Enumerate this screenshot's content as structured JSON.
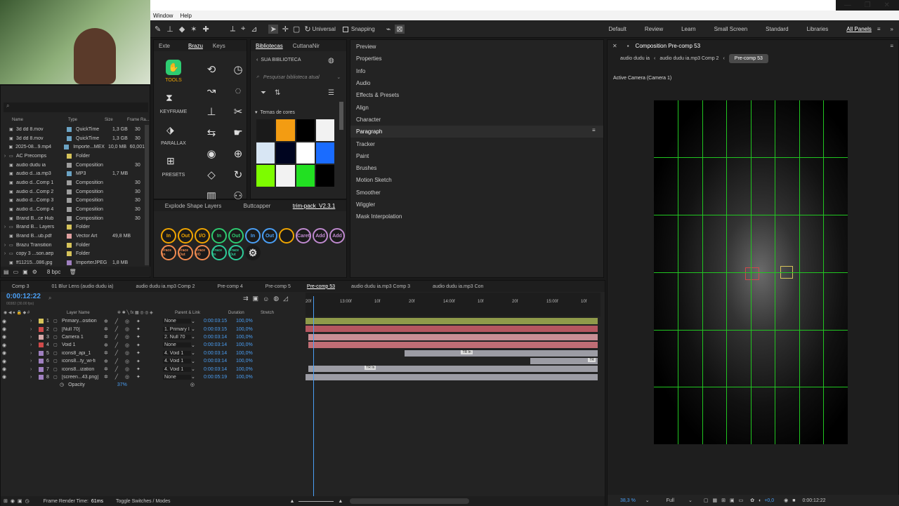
{
  "menu": {
    "window": "Window",
    "help": "Help"
  },
  "toolbar": {
    "universal": "Universal",
    "snapping": "Snapping"
  },
  "workspaces": [
    "Default",
    "Review",
    "Learn",
    "Small Screen",
    "Standard",
    "Libraries",
    "All Panels"
  ],
  "project": {
    "columns": [
      "Name",
      "Type",
      "Size",
      "Frame Ra..."
    ],
    "rows": [
      {
        "name": "3d dd 8.mov",
        "type": "QuickTime",
        "size": "1,3 GB",
        "fr": "30",
        "color": "#6ba3c4"
      },
      {
        "name": "3d dd 8.mov",
        "type": "QuickTime",
        "size": "1,3 GB",
        "fr": "30",
        "color": "#6ba3c4"
      },
      {
        "name": "2025-08...9.mp4",
        "type": "Importe...MEX",
        "size": "10,0 MB",
        "fr": "60,001",
        "color": "#6ba3c4"
      },
      {
        "name": "AC Precomps",
        "type": "Folder",
        "size": "",
        "fr": "",
        "color": "#d6c35a"
      },
      {
        "name": "audio dudu ia",
        "type": "Composition",
        "size": "",
        "fr": "30",
        "color": "#9e9e9e"
      },
      {
        "name": "audio d...ia.mp3",
        "type": "MP3",
        "size": "1,7 MB",
        "fr": "",
        "color": "#6ba3c4"
      },
      {
        "name": "audio d...Comp 1",
        "type": "Composition",
        "size": "",
        "fr": "30",
        "color": "#9e9e9e"
      },
      {
        "name": "audio d...Comp 2",
        "type": "Composition",
        "size": "",
        "fr": "30",
        "color": "#9e9e9e"
      },
      {
        "name": "audio d...Comp 3",
        "type": "Composition",
        "size": "",
        "fr": "30",
        "color": "#9e9e9e"
      },
      {
        "name": "audio d...Comp 4",
        "type": "Composition",
        "size": "",
        "fr": "30",
        "color": "#9e9e9e"
      },
      {
        "name": "Brand B...ce Hub",
        "type": "Composition",
        "size": "",
        "fr": "30",
        "color": "#9e9e9e"
      },
      {
        "name": "Brand B... Layers",
        "type": "Folder",
        "size": "",
        "fr": "",
        "color": "#d6c35a"
      },
      {
        "name": "Brand B...ub.pdf",
        "type": "Vector Art",
        "size": "49,8 MB",
        "fr": "",
        "color": "#e0a0a0"
      },
      {
        "name": "Brazu Transition",
        "type": "Folder",
        "size": "",
        "fr": "",
        "color": "#d6c35a"
      },
      {
        "name": "copy 3 ...son.aep",
        "type": "Folder",
        "size": "",
        "fr": "",
        "color": "#d6c35a"
      },
      {
        "name": "ff11215...086.jpg",
        "type": "ImporterJPEG",
        "size": "1,8 MB",
        "fr": "",
        "color": "#a080c0"
      }
    ],
    "bpc": "8 bpc"
  },
  "brazu": {
    "tabs": [
      "Exte",
      "Brazu",
      "Keys"
    ],
    "sections": [
      "TOOLS",
      "KEYFRAME",
      "PARALLAX",
      "PRESETS"
    ]
  },
  "libraries": {
    "tabs": [
      "Bibliotecas",
      "CuttanaNir"
    ],
    "sua": "SUA BIBLIOTECA",
    "search_placeholder": "Pesquisar biblioteca atual",
    "temas": "Temas de cores",
    "swatches": [
      "#1a1a1a",
      "#f39c12",
      "#000000",
      "#f2f2f2",
      "#d8e6f4",
      "#000520",
      "#ffffff",
      "#1a6cff",
      "#7dfc00",
      "#f2f2f2",
      "#22e022",
      "#000000"
    ]
  },
  "trimpack": {
    "tabs": [
      "Explode Shape Layers",
      "Buttcapper",
      "trim-pack_V2.3.1"
    ],
    "row1": [
      "In",
      "Out",
      "I/O",
      "In",
      "Out",
      "In",
      "Out",
      "",
      "Caret",
      "Add",
      "Add"
    ],
    "row2": [
      "Trace In",
      "Trace Out",
      "Trace I/O",
      "Trace In",
      "Trace Out",
      ""
    ]
  },
  "side_panels": [
    "Preview",
    "Properties",
    "Info",
    "Audio",
    "Effects & Presets",
    "Align",
    "Character",
    "Paragraph",
    "Tracker",
    "Paint",
    "Brushes",
    "Motion Sketch",
    "Smoother",
    "Wiggler",
    "Mask Interpolation"
  ],
  "viewer": {
    "title": "Composition Pre-comp 53",
    "crumbs": [
      "audio dudu ia",
      "audio dudu ia.mp3 Comp 2",
      "Pre-comp 53"
    ],
    "camera": "Active Camera (Camera 1)",
    "zoom": "38,3 %",
    "res": "Full",
    "exposure": "+0,0",
    "time": "0:00:12:22"
  },
  "timeline": {
    "tabs": [
      "Comp 3",
      "01 Blur Lens (audio dudu ia)",
      "audio dudu ia.mp3 Comp 2",
      "Pre-comp 4",
      "Pre-comp 5",
      "Pre-comp 53",
      "audio dudu ia.mp3 Comp 3",
      "audio dudu ia.mp3 Con"
    ],
    "timecode": "0:00:12:22",
    "fps": "00382 (30.00 fps)",
    "cols": {
      "layer": "Layer Name",
      "parent": "Parent & Link",
      "duration": "Duration",
      "stretch": "Stretch"
    },
    "ruler": [
      "20f",
      "13:00f",
      "10f",
      "20f",
      "14:00f",
      "10f",
      "20f",
      "15:00f",
      "10f"
    ],
    "layers": [
      {
        "n": "1",
        "name": "Primary...osition",
        "parent": "None",
        "dur": "0:00:03:15",
        "st": "100,0%",
        "color": "#d6c35a",
        "bar": [
          0,
          1
        ],
        "barcolor": "#8f9a4a"
      },
      {
        "n": "2",
        "name": "[Null 70]",
        "parent": "1. Primary I",
        "dur": "0:00:03:15",
        "st": "100,0%",
        "color": "#d04a4a",
        "bar": [
          0,
          1
        ],
        "barcolor": "#b55660"
      },
      {
        "n": "3",
        "name": "Camera 1",
        "parent": "2. Null 70",
        "dur": "0:00:03:14",
        "st": "100,0%",
        "color": "#d6a8a8",
        "bar": [
          0.01,
          1
        ],
        "barcolor": "#c98e95"
      },
      {
        "n": "4",
        "name": "Void 1",
        "parent": "None",
        "dur": "0:00:03:14",
        "st": "100,0%",
        "color": "#d04a4a",
        "bar": [
          0.01,
          1
        ],
        "barcolor": "#c06d75"
      },
      {
        "n": "5",
        "name": "icons8_api_1",
        "parent": "4. Void 1",
        "dur": "0:00:03:14",
        "st": "100,0%",
        "color": "#a080c0",
        "bar": [
          0.34,
          1
        ],
        "barcolor": "#9c9ca4",
        "marker": "TR In"
      },
      {
        "n": "6",
        "name": "icons8...ty_wi-fi",
        "parent": "4. Void 1",
        "dur": "0:00:03:14",
        "st": "100,0%",
        "color": "#a080c0",
        "bar": [
          0.77,
          1
        ],
        "barcolor": "#9c9ca4",
        "marker": "TR"
      },
      {
        "n": "7",
        "name": "icons8...ization",
        "parent": "4. Void 1",
        "dur": "0:00:03:14",
        "st": "100,0%",
        "color": "#a080c0",
        "bar": [
          0.01,
          1
        ],
        "barcolor": "#9c9ca4",
        "marker": "TR In"
      },
      {
        "n": "8",
        "name": "[screen...43.png]",
        "parent": "None",
        "dur": "0:00:05:19",
        "st": "100,0%",
        "color": "#a080c0",
        "bar": [
          0,
          1
        ],
        "barcolor": "#9c9ca4"
      }
    ],
    "opacity_label": "Opacity",
    "opacity_value": "37%",
    "frame_render": "Frame Render Time:",
    "frame_render_val": "61ms",
    "toggle": "Toggle Switches / Modes"
  }
}
